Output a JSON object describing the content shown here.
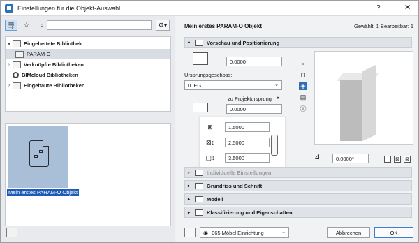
{
  "window": {
    "title": "Einstellungen für die Objekt-Auswahl",
    "help": "?",
    "close": "✕"
  },
  "left": {
    "search_value": "",
    "tree": [
      {
        "label": "Eingebettete Bibliothek",
        "chev": "▾",
        "icon": "folder-icon",
        "bold": true
      },
      {
        "label": "PARAM-O",
        "chev": "",
        "icon": "folder-icon",
        "bold": false,
        "selected": true,
        "indent": true
      },
      {
        "label": "Verknüpfte Bibliotheken",
        "chev": "›",
        "icon": "folder-icon",
        "bold": true
      },
      {
        "label": "BIMcloud Bibliotheken",
        "chev": "",
        "icon": "bimcloud-icon",
        "bold": true
      },
      {
        "label": "Eingebaute Bibliotheken",
        "chev": "›",
        "icon": "folder-icon",
        "bold": true
      }
    ],
    "preview_label": "Mein erstes PARAM-O Objekt"
  },
  "right": {
    "object_name": "Mein erstes PARAM-O Objekt",
    "selection_info": "Gewählt: 1 Bearbeitbar: 1",
    "panel_preview": "Vorschau und Positionierung",
    "elevation_value": "0.0000",
    "story_label": "Ursprungsgeschoss:",
    "story_value": "0. EG",
    "project_origin_label": "zu Projektursprung",
    "project_origin_value": "0.0000",
    "dim_x": "1.5000",
    "dim_y": "2.5000",
    "dim_z": "3.5000",
    "angle_value": "0.0000°",
    "panels": [
      {
        "label": "Individuelle Einstellungen",
        "dim": true
      },
      {
        "label": "Grundriss und Schnitt",
        "dim": false
      },
      {
        "label": "Modell",
        "dim": false
      },
      {
        "label": "Klassifizierung und Eigenschaften",
        "dim": false
      }
    ],
    "layer_value": "065 Möbel Einrichtung",
    "cancel_label": "Abbrechen",
    "ok_label": "OK"
  }
}
